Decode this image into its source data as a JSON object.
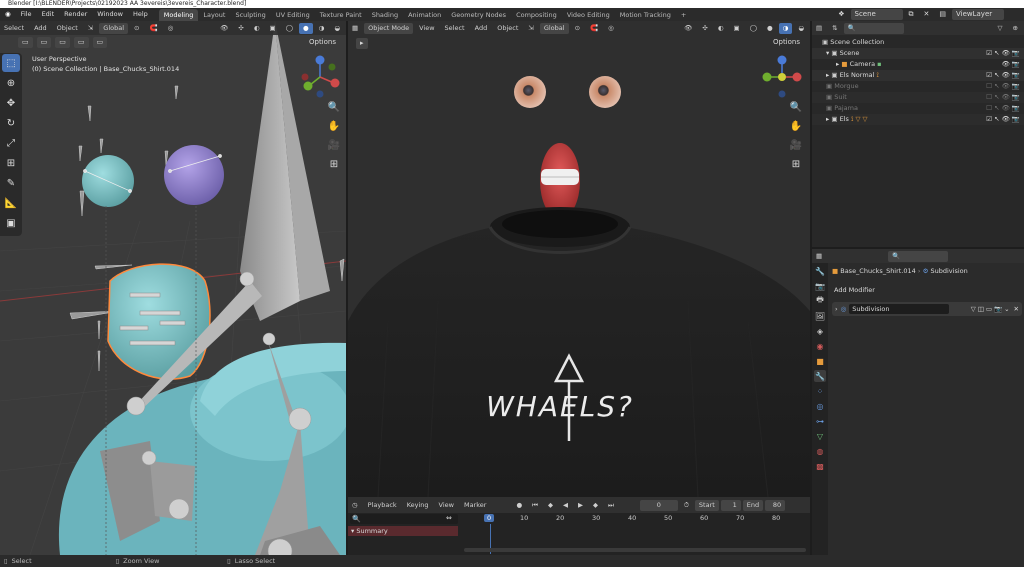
{
  "window": {
    "title": "Blender [I:\\BLENDER\\Projects\\02192023 AA 3evereis\\3evereis_Character.blend]"
  },
  "menu": {
    "items": [
      "File",
      "Edit",
      "Render",
      "Window",
      "Help"
    ]
  },
  "workspaces": {
    "tabs": [
      "Modeling",
      "Layout",
      "Sculpting",
      "UV Editing",
      "Texture Paint",
      "Shading",
      "Animation",
      "Geometry Nodes",
      "Compositing",
      "Video Editing",
      "Motion Tracking"
    ],
    "add": "+",
    "active": "Modeling"
  },
  "scene": {
    "name": "Scene",
    "viewlayer": "ViewLayer"
  },
  "left_viewport": {
    "menus": [
      "Select",
      "Add",
      "Object"
    ],
    "orientation": "Global",
    "options": "Options",
    "perspective": "User Perspective",
    "collection_info": "(0) Scene Collection | Base_Chucks_Shirt.014"
  },
  "right_viewport": {
    "mode": "Object Mode",
    "menus": [
      "View",
      "Select",
      "Add",
      "Object"
    ],
    "orientation": "Global",
    "options": "Options",
    "shirt_text": "WHAELS?"
  },
  "outliner": {
    "rows": [
      {
        "label": "Scene Collection",
        "indent": 0,
        "icon": "collection-icon",
        "disabled": false
      },
      {
        "label": "Scene",
        "indent": 1,
        "icon": "collection-icon",
        "disabled": false
      },
      {
        "label": "Camera",
        "indent": 2,
        "icon": "camera-icon",
        "disabled": false
      },
      {
        "label": "Els Normal",
        "indent": 1,
        "icon": "collection-icon",
        "disabled": false
      },
      {
        "label": "Morgue",
        "indent": 1,
        "icon": "collection-icon",
        "disabled": true
      },
      {
        "label": "Suit",
        "indent": 1,
        "icon": "collection-icon",
        "disabled": true
      },
      {
        "label": "Pajama",
        "indent": 1,
        "icon": "collection-icon",
        "disabled": true
      },
      {
        "label": "Els",
        "indent": 1,
        "icon": "collection-icon",
        "disabled": false
      }
    ]
  },
  "properties": {
    "object_name": "Base_Chucks_Shirt.014",
    "modifier_crumb": "Subdivision",
    "add_modifier": "Add Modifier",
    "modifier_name": "Subdivision"
  },
  "timeline": {
    "menus": [
      "Playback",
      "Keying",
      "View",
      "Marker"
    ],
    "current_frame": "0",
    "start_label": "Start",
    "start": "1",
    "end_label": "End",
    "end": "80",
    "ticks": [
      "0",
      "10",
      "20",
      "30",
      "40",
      "50",
      "60",
      "70",
      "80"
    ],
    "summary": "Summary"
  },
  "statusbar": {
    "items": [
      "Select",
      "Zoom View",
      "Lasso Select"
    ]
  },
  "colors": {
    "accent": "#4772b3",
    "frame": "#4772b3",
    "summary": "#5a2a2e"
  }
}
